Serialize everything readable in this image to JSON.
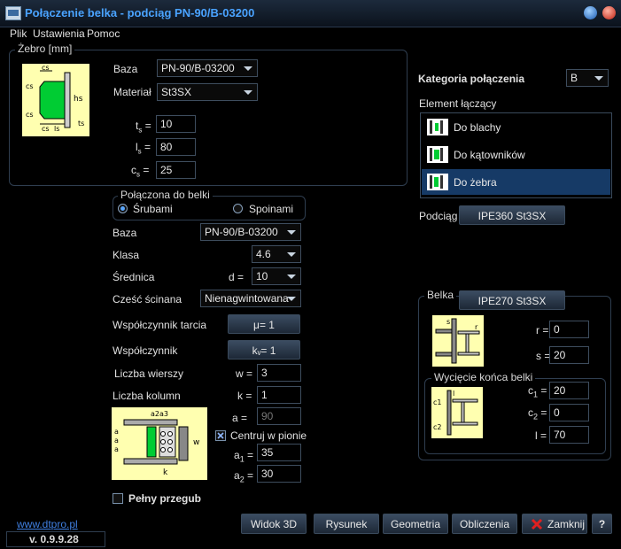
{
  "window": {
    "title": "Połączenie belka - podciąg  PN-90/B-03200"
  },
  "menu": [
    "Plik",
    "Ustawienia",
    "Pomoc"
  ],
  "zebro": {
    "group_label": "Żebro [mm]",
    "baza_label": "Baza",
    "baza_value": "PN-90/B-03200",
    "material_label": "Materiał",
    "material_value": "St3SX",
    "ts_label": "t",
    "ts_sub": "s",
    "ts_value": "10",
    "ls_label": "l",
    "ls_sub": "s",
    "ls_value": "80",
    "cs_label": "c",
    "cs_sub": "s",
    "cs_value": "25",
    "eq": "="
  },
  "kategoria": {
    "label": "Kategoria połączenia",
    "value": "B"
  },
  "element": {
    "label": "Element łączący",
    "items": [
      "Do blachy",
      "Do kątowników",
      "Do żebra"
    ],
    "selected_index": 2
  },
  "podciag": {
    "label": "Podciąg",
    "value": "IPE360 St3SX"
  },
  "polaczona": {
    "group_label": "Połączona do belki",
    "options": [
      "Śrubami",
      "Spoinami"
    ],
    "selected": "Śrubami",
    "baza_label": "Baza",
    "baza_value": "PN-90/B-03200",
    "klasa_label": "Klasa",
    "klasa_value": "4.6",
    "srednica_label": "Średnica",
    "d_label": "d =",
    "srednica_value": "10",
    "czesc_label": "Cześć ścinana",
    "czesc_value": "Nienagwintowana",
    "tarcie_label": "Współczynnik tarcia",
    "tarcie_btn": "μ= 1",
    "wsp_label": "Współczynnik",
    "wsp_btn": "kᵥ= 1",
    "wiersze_label": "Liczba wierszy",
    "w_label": "w =",
    "w_value": "3",
    "kolumny_label": "Liczba kolumn",
    "k_label": "k =",
    "k_value": "1",
    "a_label": "a =",
    "a_value": "90",
    "centruj_label": "Centruj w pionie",
    "centruj_checked": true,
    "a1_label": "a",
    "a1_sub": "1",
    "a1_value": "35",
    "a2_label": "a",
    "a2_sub": "2",
    "a2_value": "30",
    "eq": "="
  },
  "pelny": {
    "label": "Pełny przegub",
    "checked": false
  },
  "belka": {
    "group_label": "Belka",
    "value": "IPE270 St3SX",
    "r_label": "r =",
    "r_value": "0",
    "s_label": "s =",
    "s_value": "20",
    "wyciecie_label": "Wycięcie końca belki",
    "c1_label": "c",
    "c1_sub": "1",
    "c1_value": "20",
    "c2_label": "c",
    "c2_sub": "2",
    "c2_value": "0",
    "l_label": "l =",
    "l_value": "70",
    "eq": "="
  },
  "footer": {
    "link": "www.dtpro.pl",
    "version": "v.  0.9.9.28",
    "buttons": [
      "Widok 3D",
      "Rysunek",
      "Geometria",
      "Obliczenia",
      "Zamknij"
    ],
    "help": "?"
  },
  "colors": {
    "accent": "#4aa3ff",
    "background": "#000000",
    "selection": "#163a66",
    "diagram_bg": "#ffffb0",
    "green": "#00cc33"
  }
}
